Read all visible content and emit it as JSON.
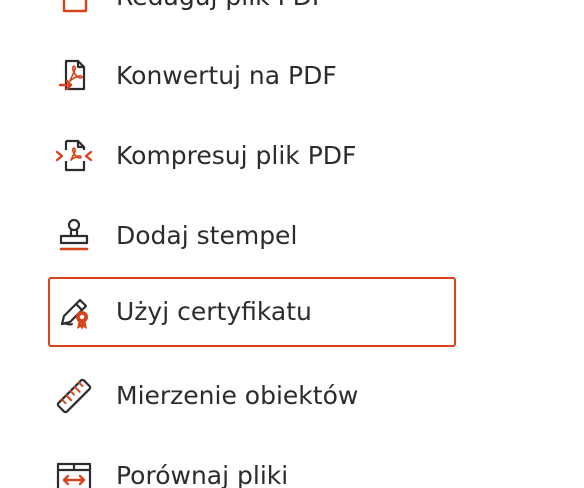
{
  "tools_menu": {
    "accent_color": "#d9431c",
    "items": [
      {
        "label": "Redaguj plik PDF",
        "icon": "edit-pdf-icon"
      },
      {
        "label": "Konwertuj na PDF",
        "icon": "convert-to-pdf-icon"
      },
      {
        "label": "Kompresuj plik PDF",
        "icon": "compress-pdf-icon"
      },
      {
        "label": "Dodaj stempel",
        "icon": "stamp-icon"
      },
      {
        "label": "Użyj certyfikatu",
        "icon": "certificate-icon",
        "selected": true
      },
      {
        "label": "Mierzenie obiektów",
        "icon": "ruler-icon"
      },
      {
        "label": "Porównaj pliki",
        "icon": "compare-files-icon"
      }
    ]
  }
}
